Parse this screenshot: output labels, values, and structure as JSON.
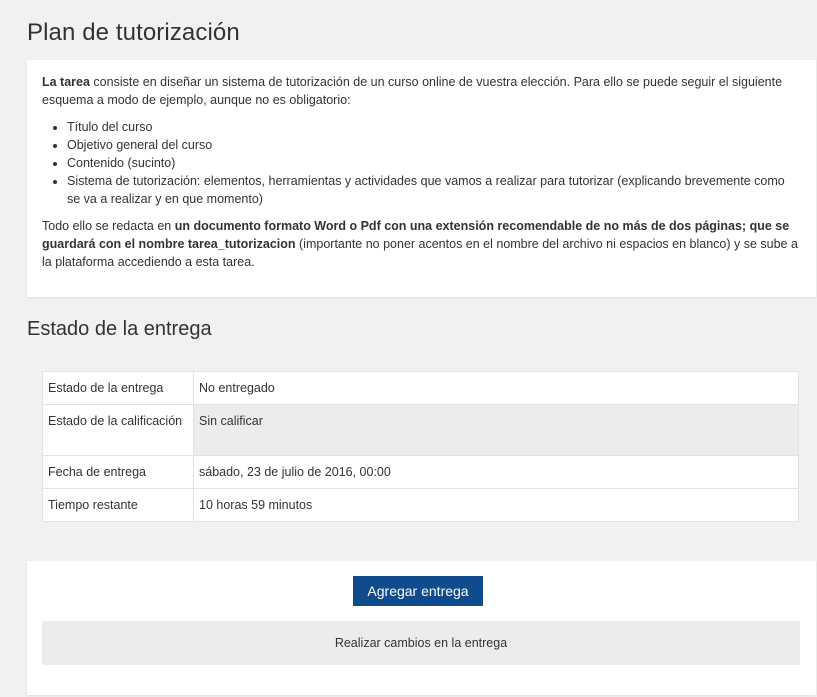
{
  "assignment": {
    "title": "Plan de tutorización",
    "intro": {
      "p1_bold": "La tarea",
      "p1_rest": " consiste en diseñar un sistema de tutorización de un curso online de  vuestra elección.  Para ello se puede seguir el siguiente esquema a modo de ejemplo, aunque no es obligatorio:",
      "list": [
        "Título del curso",
        "Objetivo general del curso",
        "Contenido (sucinto)",
        "Sistema de tutorización: elementos, herramientas y actividades que vamos a realizar para tutorizar (explicando brevemente como se va a realizar y en que momento)"
      ],
      "p2_start": "Todo ello se redacta en ",
      "p2_bold": "un documento formato Word  o Pdf con una extensión recomendable de no más de dos páginas; que se guardará con el nombre tarea_tutorizacion",
      "p2_end": " (importante no poner acentos en el nombre del archivo ni espacios en blanco) y se sube a la plataforma accediendo a esta tarea."
    }
  },
  "submission_status": {
    "heading": "Estado de la entrega",
    "rows": [
      {
        "label": "Estado de la entrega",
        "value": "No entregado"
      },
      {
        "label": "Estado de la calificación",
        "value": "Sin calificar"
      },
      {
        "label": "Fecha de entrega",
        "value": "sábado, 23 de julio de 2016, 00:00"
      },
      {
        "label": "Tiempo restante",
        "value": "10 horas 59 minutos"
      }
    ]
  },
  "actions": {
    "add_submission_label": "Agregar entrega",
    "help_text": "Realizar cambios en la entrega"
  },
  "colors": {
    "primary_button": "#0f4b8d",
    "page_background": "#f1f1f1",
    "row_highlight": "#ececec"
  }
}
